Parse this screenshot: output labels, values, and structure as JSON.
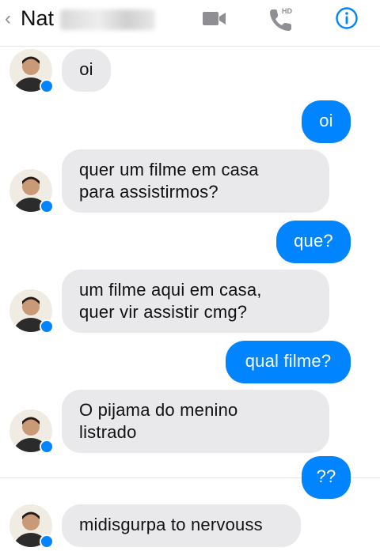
{
  "header": {
    "back_glyph": "‹",
    "contact_name": "Nat",
    "hd_label": "HD",
    "icons": [
      "back-chevron-icon",
      "video-camera-icon",
      "phone-hd-icon",
      "info-icon"
    ],
    "accent_color": "#0084ff"
  },
  "messages": [
    {
      "side": "incoming",
      "text": "oi"
    },
    {
      "side": "outgoing",
      "text": "oi"
    },
    {
      "side": "incoming",
      "text": "quer um filme em casa\npara assistirmos?"
    },
    {
      "side": "outgoing",
      "text": "que?"
    },
    {
      "side": "incoming",
      "text": "um filme aqui em casa,\nquer vir assistir cmg?"
    },
    {
      "side": "outgoing",
      "text": "qual filme?"
    },
    {
      "side": "incoming",
      "text": "O pijama do menino\nlistrado"
    },
    {
      "side": "outgoing",
      "text": "??"
    },
    {
      "side": "incoming",
      "text": "midisgurpa to nervouss"
    }
  ],
  "colors": {
    "incoming_bubble": "#e9e9eb",
    "outgoing_bubble": "#0084ff"
  }
}
